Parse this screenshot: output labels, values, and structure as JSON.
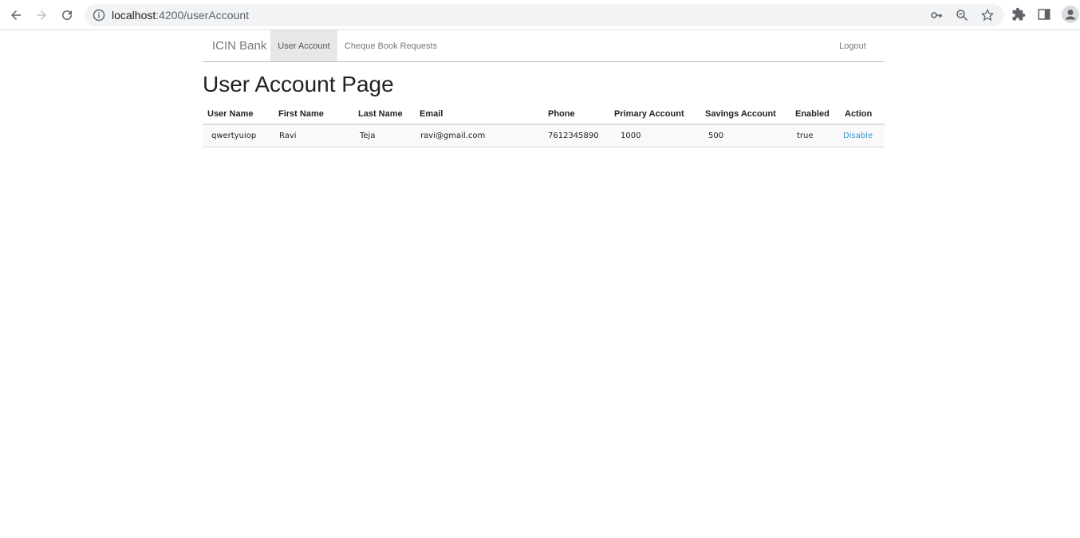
{
  "browser": {
    "url_host": "localhost",
    "url_rest": ":4200/userAccount"
  },
  "navbar": {
    "brand": "ICIN Bank",
    "items": [
      {
        "label": "User Account",
        "active": true
      },
      {
        "label": "Cheque Book Requests",
        "active": false
      }
    ],
    "logout": "Logout"
  },
  "page": {
    "title": "User Account Page"
  },
  "table": {
    "headers": [
      "User Name",
      "First Name",
      "Last Name",
      "Email",
      "Phone",
      "Primary Account",
      "Savings Account",
      "Enabled",
      "Action"
    ],
    "rows": [
      [
        "qwertyuiop",
        "Ravi",
        "Teja",
        "ravi@gmail.com",
        "7612345890",
        "1000",
        "500",
        "true",
        "Disable"
      ]
    ]
  },
  "colors": {
    "link": "#3399cc",
    "active_nav_bg": "#e7e7e7"
  }
}
